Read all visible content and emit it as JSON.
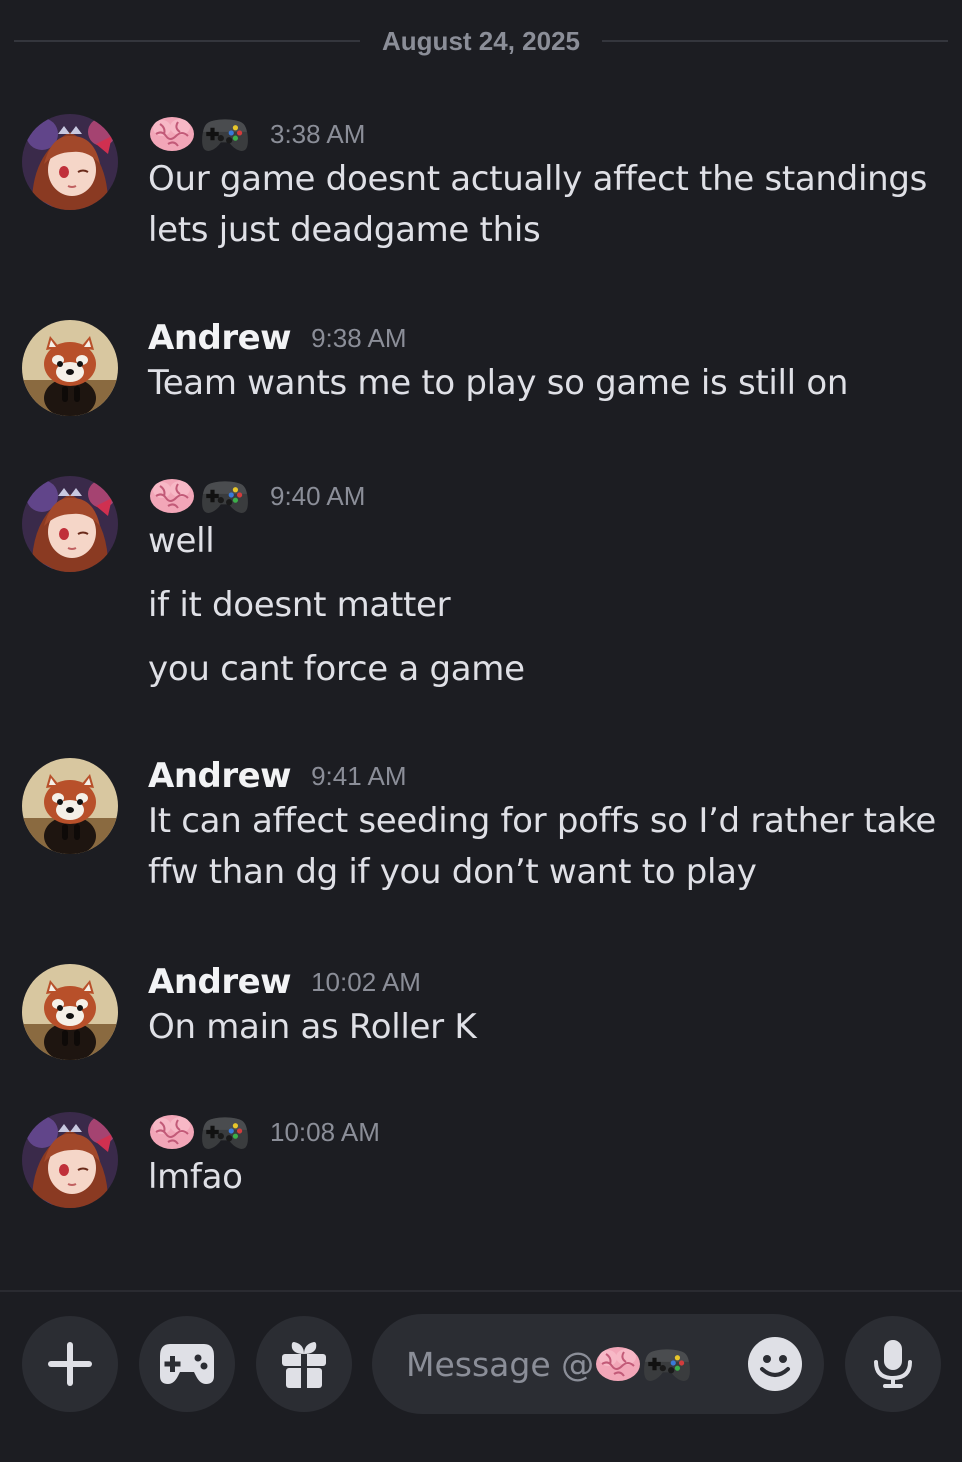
{
  "date_divider": "August 24, 2025",
  "users": {
    "emoji_user": {
      "display": "🧠🎮"
    },
    "andrew": {
      "display": "Andrew"
    }
  },
  "messages": [
    {
      "author": "🧠🎮",
      "time": "3:38 AM",
      "lines": [
        "Our game doesnt actually affect the standings lets just deadgame this"
      ]
    },
    {
      "author": "Andrew",
      "time": "9:38 AM",
      "lines": [
        "Team wants me to play so game is still on"
      ]
    },
    {
      "author": "🧠🎮",
      "time": "9:40 AM",
      "lines": [
        "well",
        "if it doesnt matter",
        "you cant force a game"
      ]
    },
    {
      "author": "Andrew",
      "time": "9:41 AM",
      "lines": [
        "It can affect seeding for poffs so I’d rather take ffw than dg if you don’t want to play"
      ]
    },
    {
      "author": "Andrew",
      "time": "10:02 AM",
      "lines": [
        "On main as Roller K"
      ]
    },
    {
      "author": "🧠🎮",
      "time": "10:08 AM",
      "lines": [
        "lmfao"
      ]
    }
  ],
  "composer": {
    "placeholder": "Message @",
    "placeholder_suffix": "🧠🎮",
    "buttons": [
      "plus-icon",
      "gamepad-icon",
      "gift-icon",
      "smile-icon",
      "microphone-icon"
    ]
  },
  "colors": {
    "background": "#1c1d22",
    "surface": "#2b2d33",
    "muted_text": "#8b8e98",
    "text": "#dfe0e6"
  }
}
